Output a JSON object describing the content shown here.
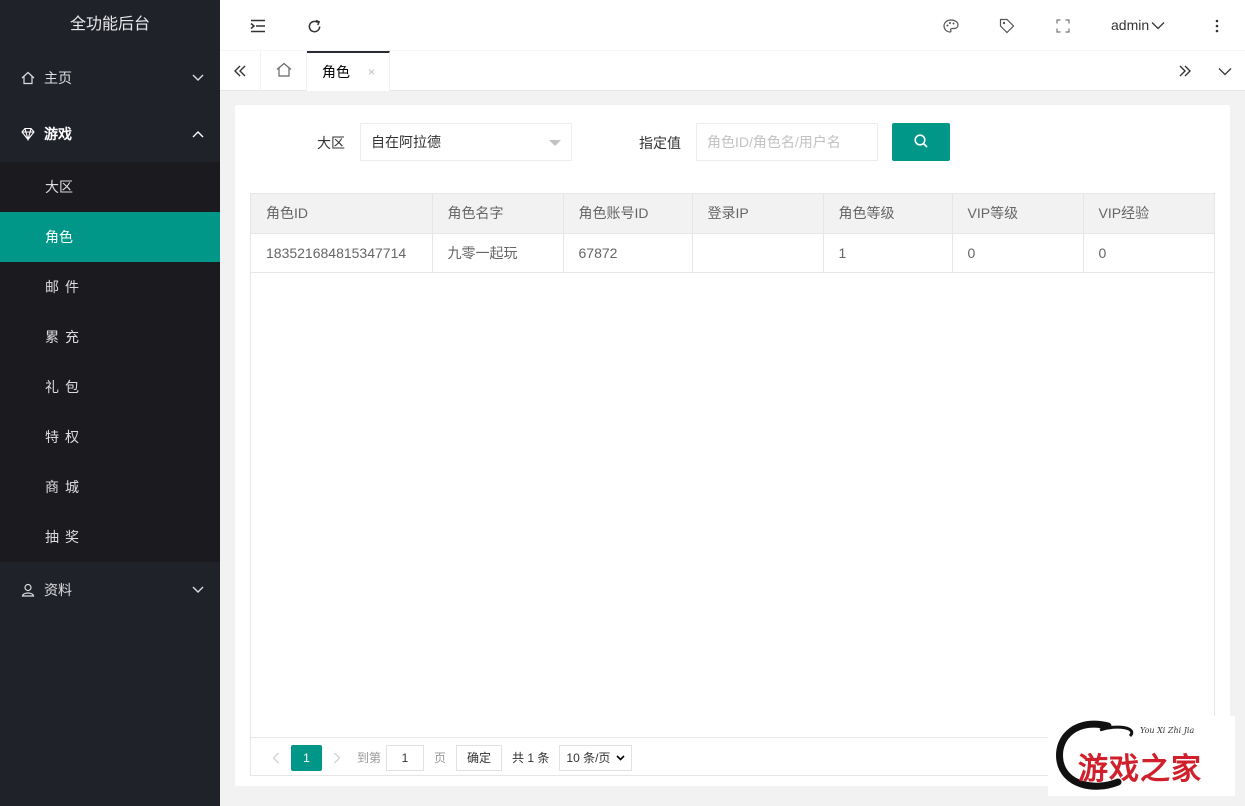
{
  "app": {
    "title": "全功能后台"
  },
  "sidebar": {
    "home": {
      "label": "主页",
      "icon": "home-icon"
    },
    "game": {
      "label": "游戏",
      "icon": "diamond-icon"
    },
    "game_items": [
      {
        "label": "大区"
      },
      {
        "label": "角色",
        "active": true
      },
      {
        "label": "邮件"
      },
      {
        "label": "累充"
      },
      {
        "label": "礼包"
      },
      {
        "label": "特权"
      },
      {
        "label": "商城"
      },
      {
        "label": "抽奖"
      }
    ],
    "data": {
      "label": "资料",
      "icon": "user-icon"
    }
  },
  "header": {
    "user": "admin"
  },
  "tabs": {
    "active_label": "角色",
    "close": "×"
  },
  "filters": {
    "region_label": "大区",
    "region_value": "自在阿拉德",
    "value_label": "指定值",
    "value_placeholder": "角色ID/角色名/用户名"
  },
  "table": {
    "columns": [
      "角色ID",
      "角色名字",
      "角色账号ID",
      "登录IP",
      "角色等级",
      "VIP等级",
      "VIP经验"
    ],
    "rows": [
      [
        "183521684815347714",
        "九零一起玩",
        "67872",
        "",
        "1",
        "0",
        "0"
      ]
    ]
  },
  "pager": {
    "current": "1",
    "goto_prefix": "到第",
    "goto_value": "1",
    "goto_suffix": "页",
    "confirm": "确定",
    "total": "共 1 条",
    "page_size": "10 条/页"
  },
  "watermark": {
    "en": "You Xi Zhi Jia",
    "cn": "游戏之家"
  },
  "colors": {
    "sidebar_bg": "#20222a",
    "accent": "#009688"
  }
}
